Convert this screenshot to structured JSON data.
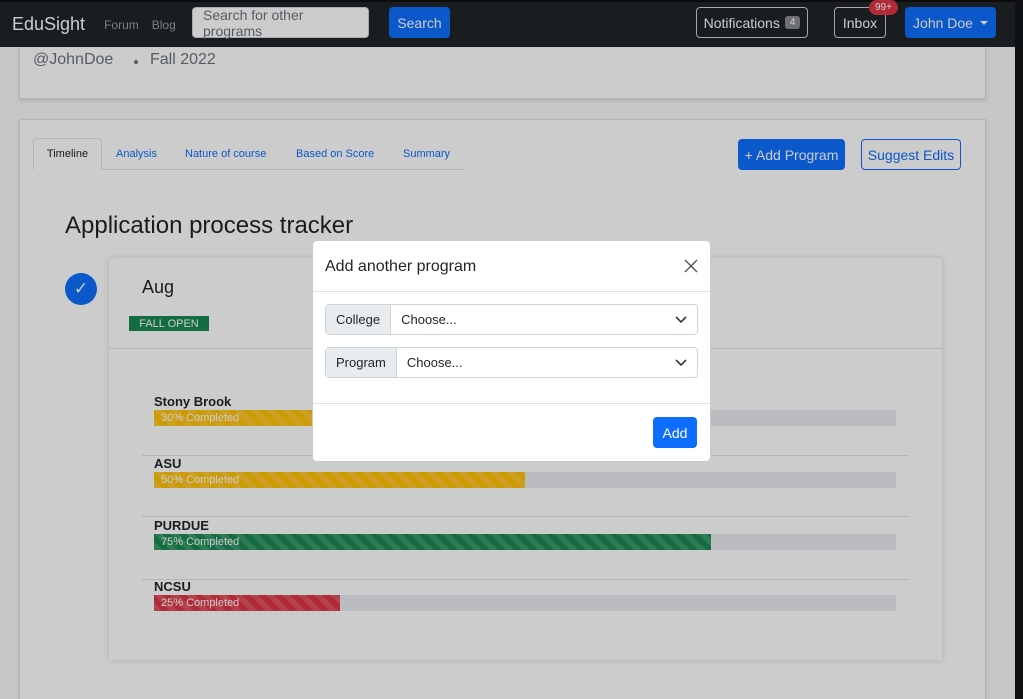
{
  "navbar": {
    "brand": "EduSight",
    "links": [
      "Forum",
      "Blog"
    ],
    "search_placeholder": "Search for other programs",
    "search_label": "Search",
    "notifications_label": "Notifications",
    "notifications_count": "4",
    "inbox_label": "Inbox",
    "inbox_badge": "99+",
    "user_label": "John Doe"
  },
  "profile": {
    "handle": "@JohnDoe",
    "term": "Fall 2022"
  },
  "tabs": [
    "Timeline",
    "Analysis",
    "Nature of course",
    "Based on Score",
    "Summary"
  ],
  "actions": {
    "add_program": "+ Add Program",
    "suggest_edits": "Suggest Edits"
  },
  "tracker": {
    "title": "Application process tracker",
    "check_glyph": "✓",
    "month": "Aug",
    "badge": "FALL OPEN",
    "programs": [
      {
        "name": "Stony Brook",
        "label": "30% Completed",
        "percent": 30,
        "color": "#ffc107"
      },
      {
        "name": "ASU",
        "label": "50% Completed",
        "percent": 50,
        "color": "#ffc107"
      },
      {
        "name": "PURDUE",
        "label": "75% Completed",
        "percent": 75,
        "color": "#198754"
      },
      {
        "name": "NCSU",
        "label": "25% Completed",
        "percent": 25,
        "color": "#dc3545"
      }
    ]
  },
  "modal": {
    "title": "Add another program",
    "college_label": "College",
    "college_value": "Choose...",
    "program_label": "Program",
    "program_value": "Choose...",
    "add_label": "Add"
  }
}
